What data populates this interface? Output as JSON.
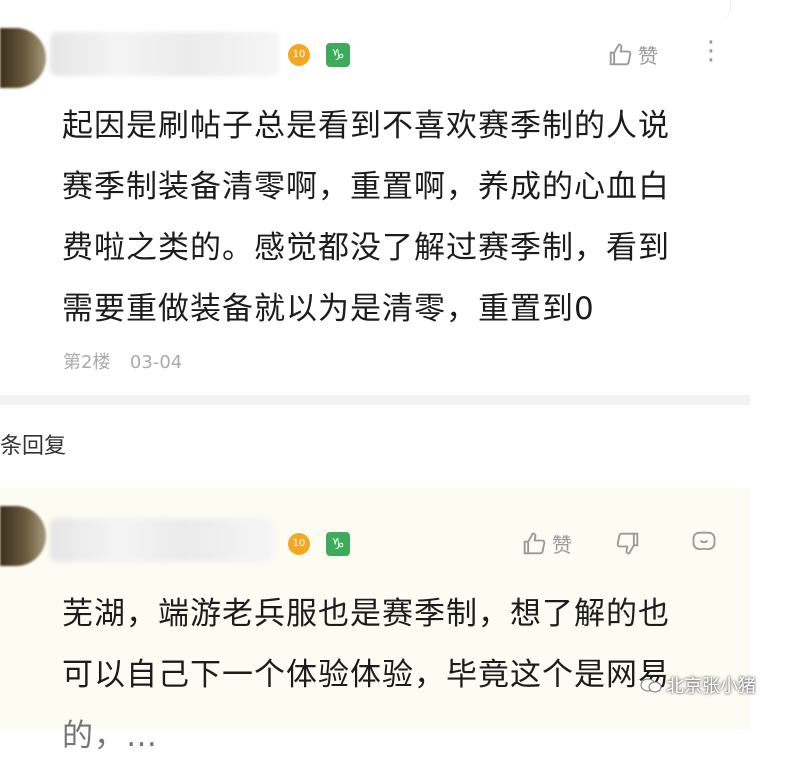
{
  "post": {
    "level_badge": "10",
    "zodiac_badge": "♑",
    "like_label": "赞",
    "text": "起因是刷帖子总是看到不喜欢赛季制的人说赛季制装备清零啊，重置啊，养成的心血白费啦之类的。感觉都没了解过赛季制，看到需要重做装备就以为是清零，重置到0",
    "lines": [
      "起因是刷帖子总是看到不喜欢赛季制的人说",
      "赛季制装备清零啊，重置啊，养成的心血白",
      "费啦之类的。感觉都没了解过赛季制，看到",
      "需要重做装备就以为是清零，重置到0"
    ],
    "floor": "第2楼",
    "date": "03-04"
  },
  "reply_count_label": "条回复",
  "reply": {
    "level_badge": "10",
    "zodiac_badge": "♑",
    "like_label": "赞",
    "lines": [
      "芜湖，端游老兵服也是赛季制，想了解的也",
      "可以自己下一个体验体验，毕竟这个是网易",
      "的，…"
    ]
  },
  "watermark": "北京张小猪",
  "colors": {
    "reply_bg": "#fdfcf2",
    "badge_orange": "#f5a623",
    "badge_green": "#3dab5a",
    "meta_gray": "#aaaaaa"
  },
  "icons": [
    "thumbs-up-icon",
    "more-icon",
    "dislike-icon",
    "comment-icon",
    "watermark-logo-icon"
  ]
}
